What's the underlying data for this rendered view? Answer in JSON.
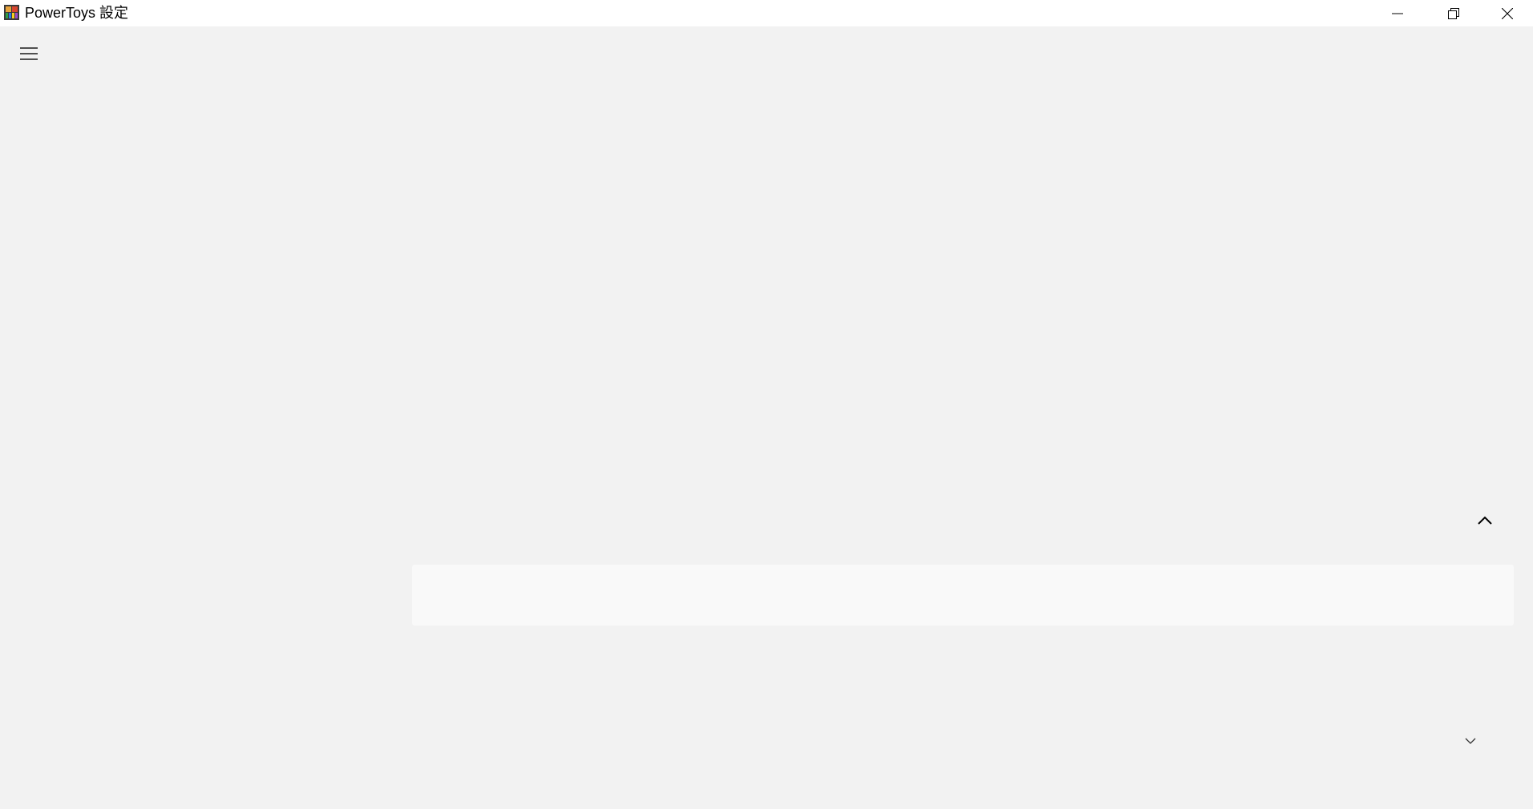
{
  "window": {
    "title": "PowerToys 設定",
    "app_icon": "powertoys-app-icon",
    "caption_buttons": {
      "minimize": "minimize-icon",
      "maximize": "restore-icon",
      "close": "close-icon"
    }
  },
  "nav": {
    "toggle_icon": "hamburger-menu-icon"
  },
  "content": {
    "collapse_icon": "chevron-up-icon",
    "expand_icon": "chevron-down-icon"
  },
  "colors": {
    "titlebar": "#ffffff",
    "background": "#f2f2f2",
    "panel": "#f9f9f9"
  }
}
